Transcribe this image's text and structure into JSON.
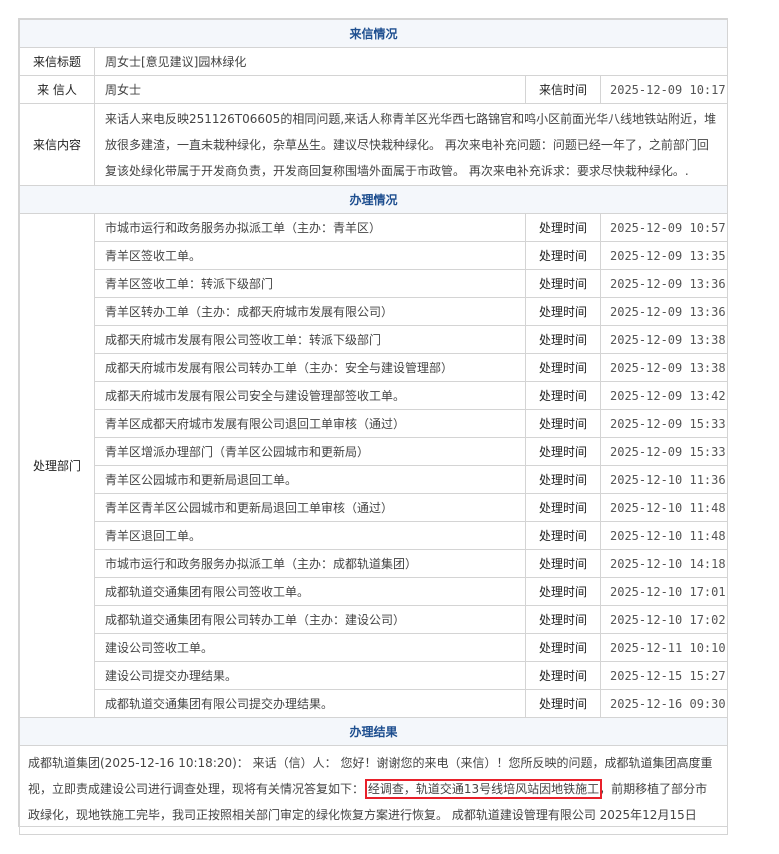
{
  "letter": {
    "section_title": "来信情况",
    "title_label": "来信标题",
    "title_value": "周女士[意见建议]园林绿化",
    "sender_label": "来 信人",
    "sender_value": "周女士",
    "time_label": "来信时间",
    "time_value": "2025-12-09 10:17",
    "content_label": "来信内容",
    "content_value": "来话人来电反映251126T06605的相同问题,来话人称青羊区光华西七路锦官和鸣小区前面光华八线地铁站附近，堆放很多建渣，一直未栽种绿化，杂草丛生。建议尽快栽种绿化。 再次来电补充问题：问题已经一年了，之前部门回复该处绿化带属于开发商负责，开发商回复称围墙外面属于市政管。 再次来电补充诉求：要求尽快栽种绿化。."
  },
  "processing": {
    "section_title": "办理情况",
    "dept_label": "处理部门",
    "steps": [
      {
        "action": "市城市运行和政务服务办拟派工单（主办：青羊区）",
        "time_label": "处理时间",
        "time": "2025-12-09 10:57"
      },
      {
        "action": "青羊区签收工单。",
        "time_label": "处理时间",
        "time": "2025-12-09 13:35"
      },
      {
        "action": "青羊区签收工单：转派下级部门",
        "time_label": "处理时间",
        "time": "2025-12-09 13:36"
      },
      {
        "action": "青羊区转办工单（主办：成都天府城市发展有限公司）",
        "time_label": "处理时间",
        "time": "2025-12-09 13:36"
      },
      {
        "action": "成都天府城市发展有限公司签收工单：转派下级部门",
        "time_label": "处理时间",
        "time": "2025-12-09 13:38"
      },
      {
        "action": "成都天府城市发展有限公司转办工单（主办：安全与建设管理部）",
        "time_label": "处理时间",
        "time": "2025-12-09 13:38"
      },
      {
        "action": "成都天府城市发展有限公司安全与建设管理部签收工单。",
        "time_label": "处理时间",
        "time": "2025-12-09 13:42"
      },
      {
        "action": "青羊区成都天府城市发展有限公司退回工单审核（通过）",
        "time_label": "处理时间",
        "time": "2025-12-09 15:33"
      },
      {
        "action": "青羊区增派办理部门（青羊区公园城市和更新局）",
        "time_label": "处理时间",
        "time": "2025-12-09 15:33"
      },
      {
        "action": "青羊区公园城市和更新局退回工单。",
        "time_label": "处理时间",
        "time": "2025-12-10 11:36"
      },
      {
        "action": "青羊区青羊区公园城市和更新局退回工单审核（通过）",
        "time_label": "处理时间",
        "time": "2025-12-10 11:48"
      },
      {
        "action": "青羊区退回工单。",
        "time_label": "处理时间",
        "time": "2025-12-10 11:48"
      },
      {
        "action": "市城市运行和政务服务办拟派工单（主办：成都轨道集团）",
        "time_label": "处理时间",
        "time": "2025-12-10 14:18"
      },
      {
        "action": "成都轨道交通集团有限公司签收工单。",
        "time_label": "处理时间",
        "time": "2025-12-10 17:01"
      },
      {
        "action": "成都轨道交通集团有限公司转办工单（主办：建设公司）",
        "time_label": "处理时间",
        "time": "2025-12-10 17:02"
      },
      {
        "action": "建设公司签收工单。",
        "time_label": "处理时间",
        "time": "2025-12-11 10:10"
      },
      {
        "action": "建设公司提交办理结果。",
        "time_label": "处理时间",
        "time": "2025-12-15 15:27"
      },
      {
        "action": "成都轨道交通集团有限公司提交办理结果。",
        "time_label": "处理时间",
        "time": "2025-12-16 09:30"
      }
    ]
  },
  "result": {
    "section_title": "办理结果",
    "text_before": "成都轨道集团(2025-12-16 10:18:20)： 来话（信）人： 您好！谢谢您的来电（来信）！您所反映的问题，成都轨道集团高度重视，立即责成建设公司进行调查处理，现将有关情况答复如下： ",
    "text_highlight": "经调查，轨道交通13号线培风站因地铁施工",
    "text_after": "，前期移植了部分市政绿化，现地铁施工完毕，我司正按照相关部门审定的绿化恢复方案进行恢复。 成都轨道建设管理有限公司 2025年12月15日",
    "highlight_color": "#e8202a"
  },
  "colors": {
    "section_title": "#1d4e8f",
    "border": "#d4d4d4"
  }
}
